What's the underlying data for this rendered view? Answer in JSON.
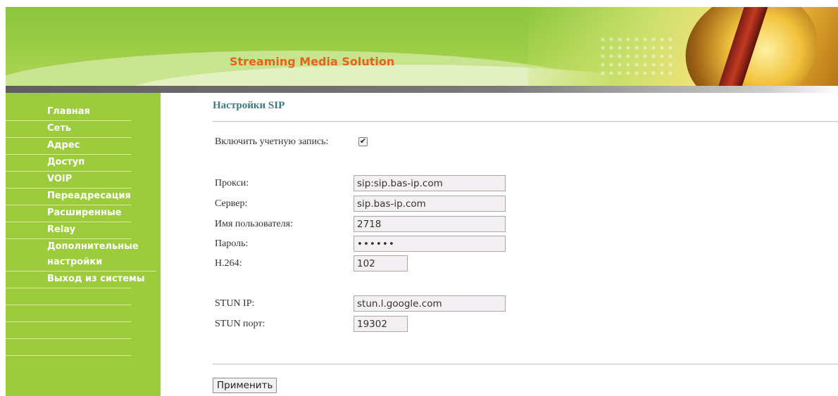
{
  "header": {
    "title": "Streaming Media Solution"
  },
  "sidebar": {
    "items": [
      {
        "label": "Главная"
      },
      {
        "label": "Сеть"
      },
      {
        "label": "Адрес"
      },
      {
        "label": "Доступ"
      },
      {
        "label": "VOIP"
      },
      {
        "label": "Переадресация"
      },
      {
        "label": "Расширенные"
      },
      {
        "label": "Relay"
      },
      {
        "label": "Дополнительные настройки"
      },
      {
        "label": "Выход из системы"
      }
    ]
  },
  "main": {
    "title": "Настройки SIP",
    "enable_account": {
      "label": "Включить учетную запись:",
      "checked": true,
      "check_glyph": "✔"
    },
    "fields": {
      "proxy": {
        "label": "Прокси:",
        "value": "sip:sip.bas-ip.com"
      },
      "server": {
        "label": "Сервер:",
        "value": "sip.bas-ip.com"
      },
      "username": {
        "label": "Имя пользователя:",
        "value": "2718"
      },
      "password": {
        "label": "Пароль:",
        "value": "••••••"
      },
      "h264": {
        "label": "H.264:",
        "value": "102"
      },
      "stun_ip": {
        "label": "STUN IP:",
        "value": "stun.l.google.com"
      },
      "stun_port": {
        "label": "STUN порт:",
        "value": "19302"
      }
    },
    "apply_label": "Применить"
  },
  "colors": {
    "sidebar_bg": "#9ccc3c",
    "banner_green": "#8cc63f",
    "title_color": "#3d7a7f",
    "header_title_color": "#e8621a"
  }
}
